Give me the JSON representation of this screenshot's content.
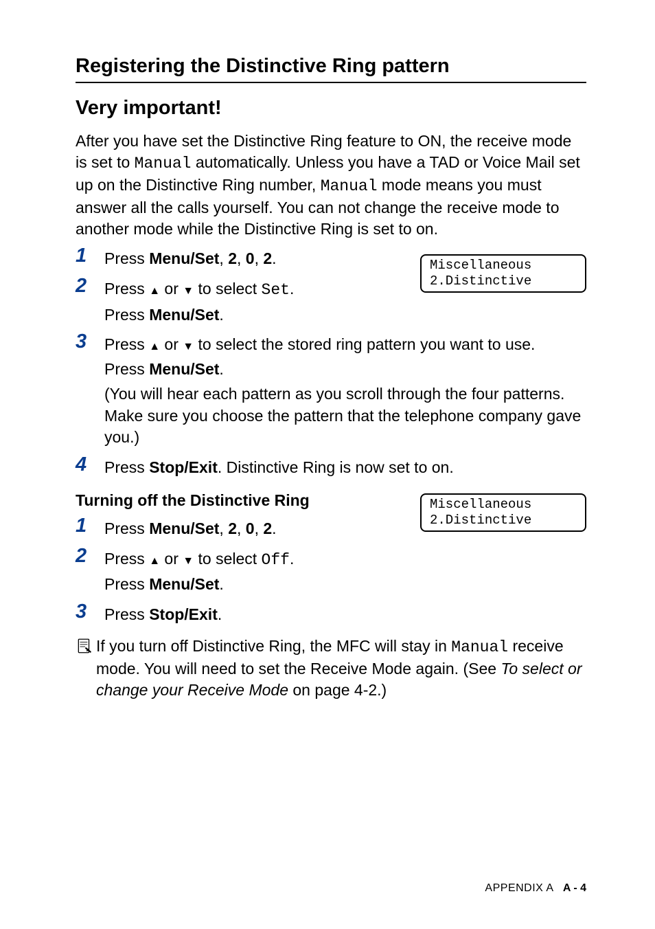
{
  "heading": "Registering the Distinctive Ring pattern",
  "subheading": "Very important!",
  "intro": {
    "part1": "After you have set the Distinctive Ring feature to ON, the receive mode is set to ",
    "mono1": "Manual",
    "part2": " automatically. Unless you have a TAD or Voice Mail set up on the Distinctive Ring number, ",
    "mono2": "Manual",
    "part3": " mode means you must answer all the calls yourself. You can not change the receive mode to another mode while the Distinctive Ring is set to on."
  },
  "steps1": [
    {
      "num": "1",
      "prefix": "Press ",
      "bold": "Menu/Set",
      "suffix": ", ",
      "b2": "2",
      "s2": ", ",
      "b3": "0",
      "s3": ", ",
      "b4": "2",
      "s4": "."
    },
    {
      "num": "2",
      "line1_prefix": "Press ",
      "line1_mid": " or ",
      "line1_suffix": " to select ",
      "line1_mono": "Set",
      "line1_end": ".",
      "line2_prefix": "Press ",
      "line2_bold": "Menu/Set",
      "line2_suffix": "."
    },
    {
      "num": "3",
      "line1_prefix": "Press ",
      "line1_mid": " or ",
      "line1_suffix": " to select the stored ring pattern you want to use.",
      "line2_prefix": "Press ",
      "line2_bold": "Menu/Set",
      "line2_suffix": ".",
      "paren": "(You will hear each pattern as you scroll through the four patterns. Make sure you choose the pattern that the telephone company gave you.)"
    },
    {
      "num": "4",
      "prefix": "Press ",
      "bold": "Stop/Exit",
      "suffix": ". Distinctive Ring is now set to on."
    }
  ],
  "lcd1": {
    "line1": "Miscellaneous",
    "line2": "2.Distinctive"
  },
  "subsection": "Turning off the Distinctive Ring",
  "steps2": [
    {
      "num": "1",
      "prefix": "Press ",
      "bold": "Menu/Set",
      "suffix": ", ",
      "b2": "2",
      "s2": ", ",
      "b3": "0",
      "s3": ", ",
      "b4": "2",
      "s4": "."
    },
    {
      "num": "2",
      "line1_prefix": "Press ",
      "line1_mid": " or ",
      "line1_suffix": " to select ",
      "line1_mono": "Off",
      "line1_end": ".",
      "line2_prefix": "Press ",
      "line2_bold": "Menu/Set",
      "line2_suffix": "."
    },
    {
      "num": "3",
      "prefix": "Press ",
      "bold": "Stop/Exit",
      "suffix": "."
    }
  ],
  "lcd2": {
    "line1": "Miscellaneous",
    "line2": "2.Distinctive"
  },
  "note": {
    "part1": "If you turn off Distinctive Ring, the MFC will stay in ",
    "mono": "Manual",
    "part2": " receive mode. You will need to set the Receive Mode again. (See ",
    "italic": "To select or change your Receive Mode",
    "part3": " on page 4-2.)"
  },
  "footer": {
    "label": "APPENDIX A",
    "page": "A - 4"
  }
}
